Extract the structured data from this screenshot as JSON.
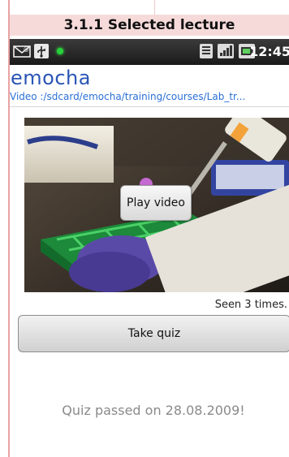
{
  "caption": "3.1.1 Selected lecture",
  "status_bar": {
    "time": "12:45",
    "icons": [
      "mail-icon",
      "usb-icon",
      "notification-led-icon",
      "wifi-icon",
      "signal-icon",
      "battery-icon"
    ],
    "led_color": "#27d13a"
  },
  "app": {
    "title": "emocha",
    "title_color": "#2a55b5",
    "path": "Video :/sdcard/emocha/training/courses/Lab_tr..."
  },
  "video": {
    "play_label": "Play video"
  },
  "seen_text": "Seen 3 times.",
  "quiz": {
    "button_label": "Take quiz",
    "status": "Quiz passed on 28.08.2009!"
  }
}
